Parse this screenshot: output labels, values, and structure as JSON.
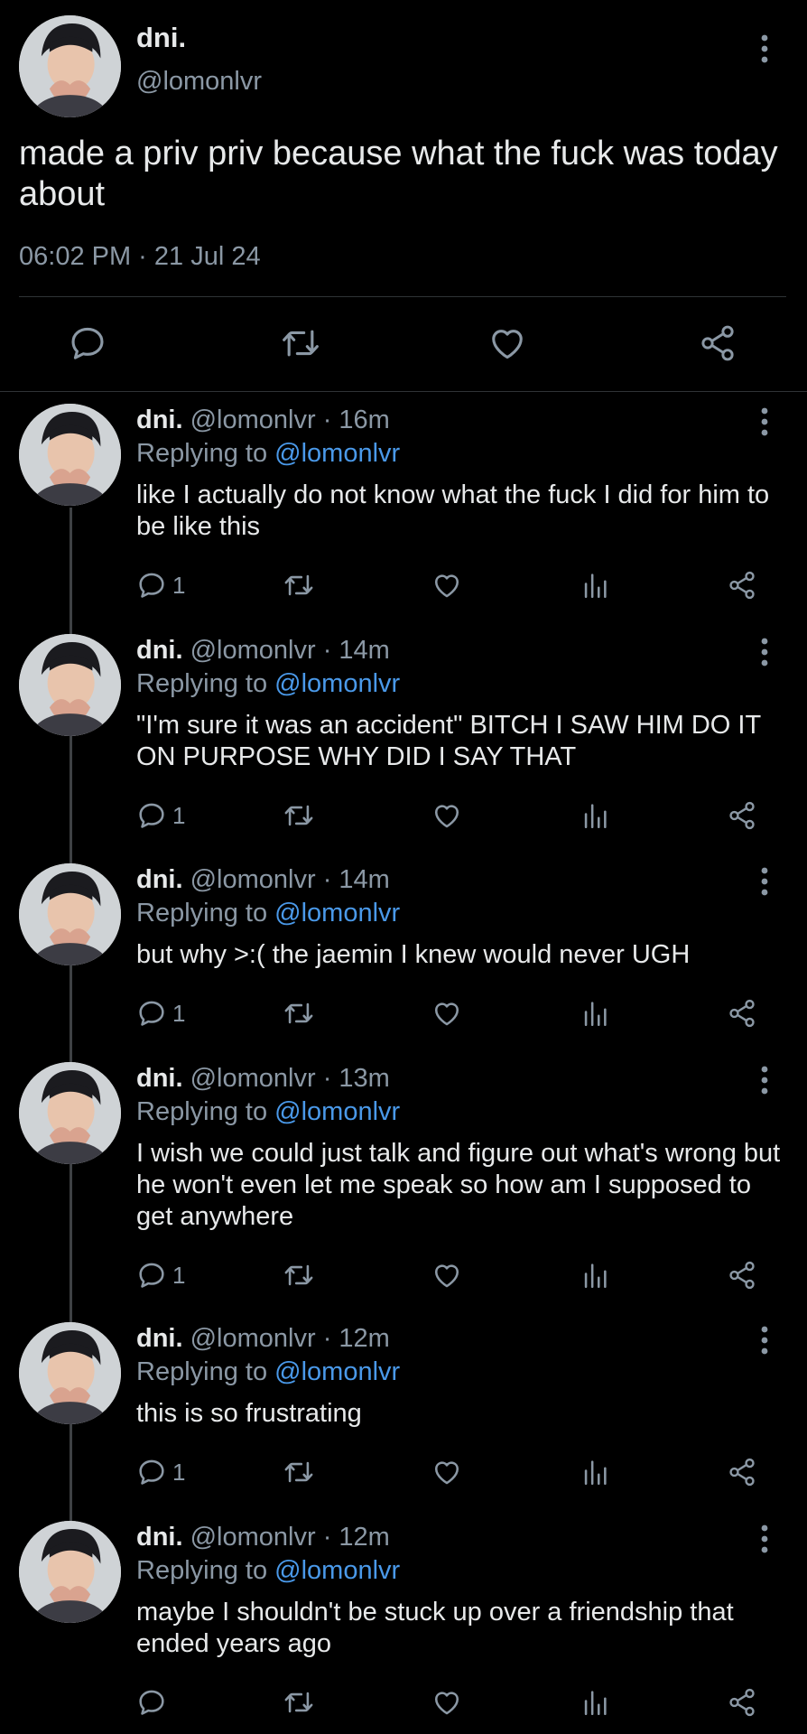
{
  "main": {
    "name": "dni.",
    "handle": "@lomonlvr",
    "text": "made a priv priv because what the fuck was today about",
    "timestamp": "06:02 PM · 21 Jul 24"
  },
  "replying_label": "Replying to",
  "replying_handle": "@lomonlvr",
  "replies": [
    {
      "name": "dni.",
      "meta": "@lomonlvr · 16m",
      "text": "like I actually do not know what the fuck I did for him to be like this",
      "reply_count": "1"
    },
    {
      "name": "dni.",
      "meta": "@lomonlvr · 14m",
      "text": "\"I'm sure it was an accident\" BITCH I SAW HIM DO IT ON PURPOSE WHY DID I SAY THAT",
      "reply_count": "1"
    },
    {
      "name": "dni.",
      "meta": "@lomonlvr · 14m",
      "text": "but why >:( the jaemin I knew would never UGH",
      "reply_count": "1"
    },
    {
      "name": "dni.",
      "meta": "@lomonlvr · 13m",
      "text": "I wish we could just talk and figure out what's wrong but he won't even let me speak so how am I supposed to get anywhere",
      "reply_count": "1"
    },
    {
      "name": "dni.",
      "meta": "@lomonlvr · 12m",
      "text": "this is so frustrating",
      "reply_count": "1"
    },
    {
      "name": "dni.",
      "meta": "@lomonlvr · 12m",
      "text": "maybe I shouldn't be stuck up over a friendship that ended years ago",
      "reply_count": ""
    }
  ],
  "icons": {
    "reply": "speech-bubble-icon",
    "retweet": "retweet-icon",
    "like": "heart-icon",
    "views": "analytics-icon",
    "share": "share-icon",
    "more": "more-vertical-icon"
  },
  "colors": {
    "background": "#000000",
    "text": "#e7e9ea",
    "secondary": "#8b98a5",
    "link": "#4a99e9",
    "divider": "#2f3336"
  }
}
